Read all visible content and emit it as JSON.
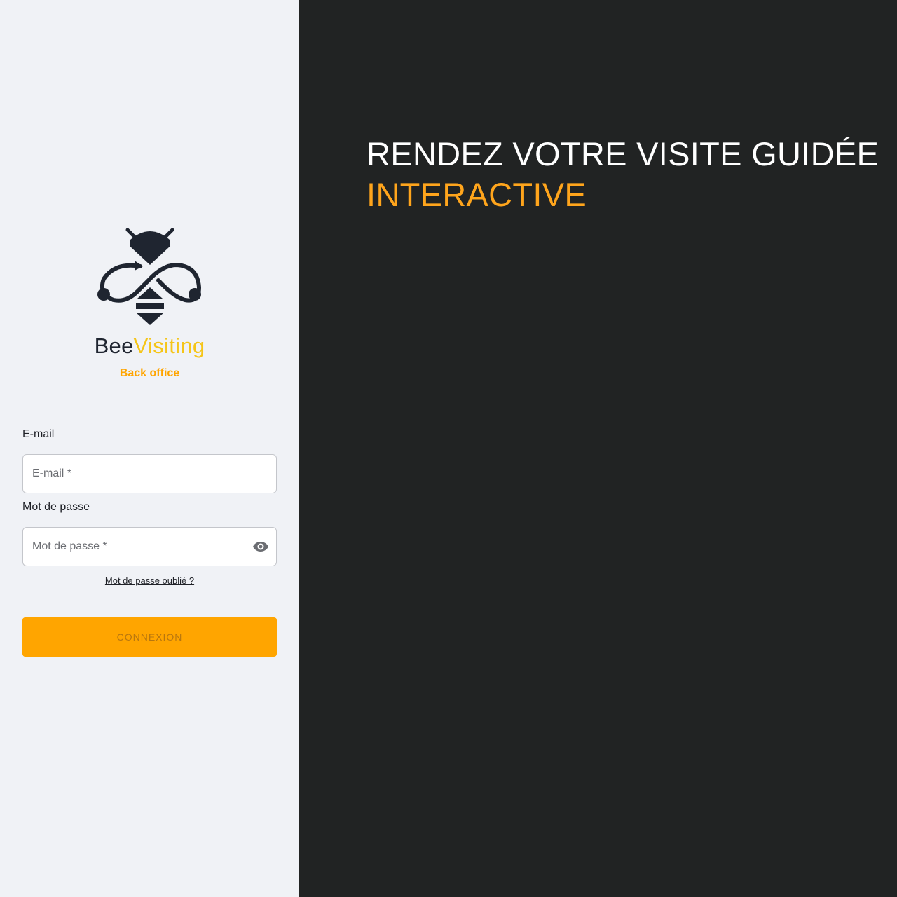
{
  "brand": {
    "name_part1": "Bee",
    "name_part2": "Visiting",
    "subtitle": "Back office",
    "logo_icon": "bee-logo-icon",
    "dark_color": "#1f2530",
    "yellow_color": "#f5c518"
  },
  "login_form": {
    "email_label": "E-mail",
    "email_placeholder": "E-mail *",
    "email_value": "",
    "password_label": "Mot de passe",
    "password_placeholder": "Mot de passe *",
    "password_value": "",
    "visibility_icon": "eye-icon",
    "forgot_password": "Mot de passe oublié ?",
    "submit_label": "CONNEXION"
  },
  "hero": {
    "line1": "RENDEZ VOTRE VISITE GUIDÉE",
    "line2": "INTERACTIVE"
  },
  "colors": {
    "accent": "#ffa500",
    "left_background": "#f0f2f6",
    "right_background": "#212323"
  }
}
